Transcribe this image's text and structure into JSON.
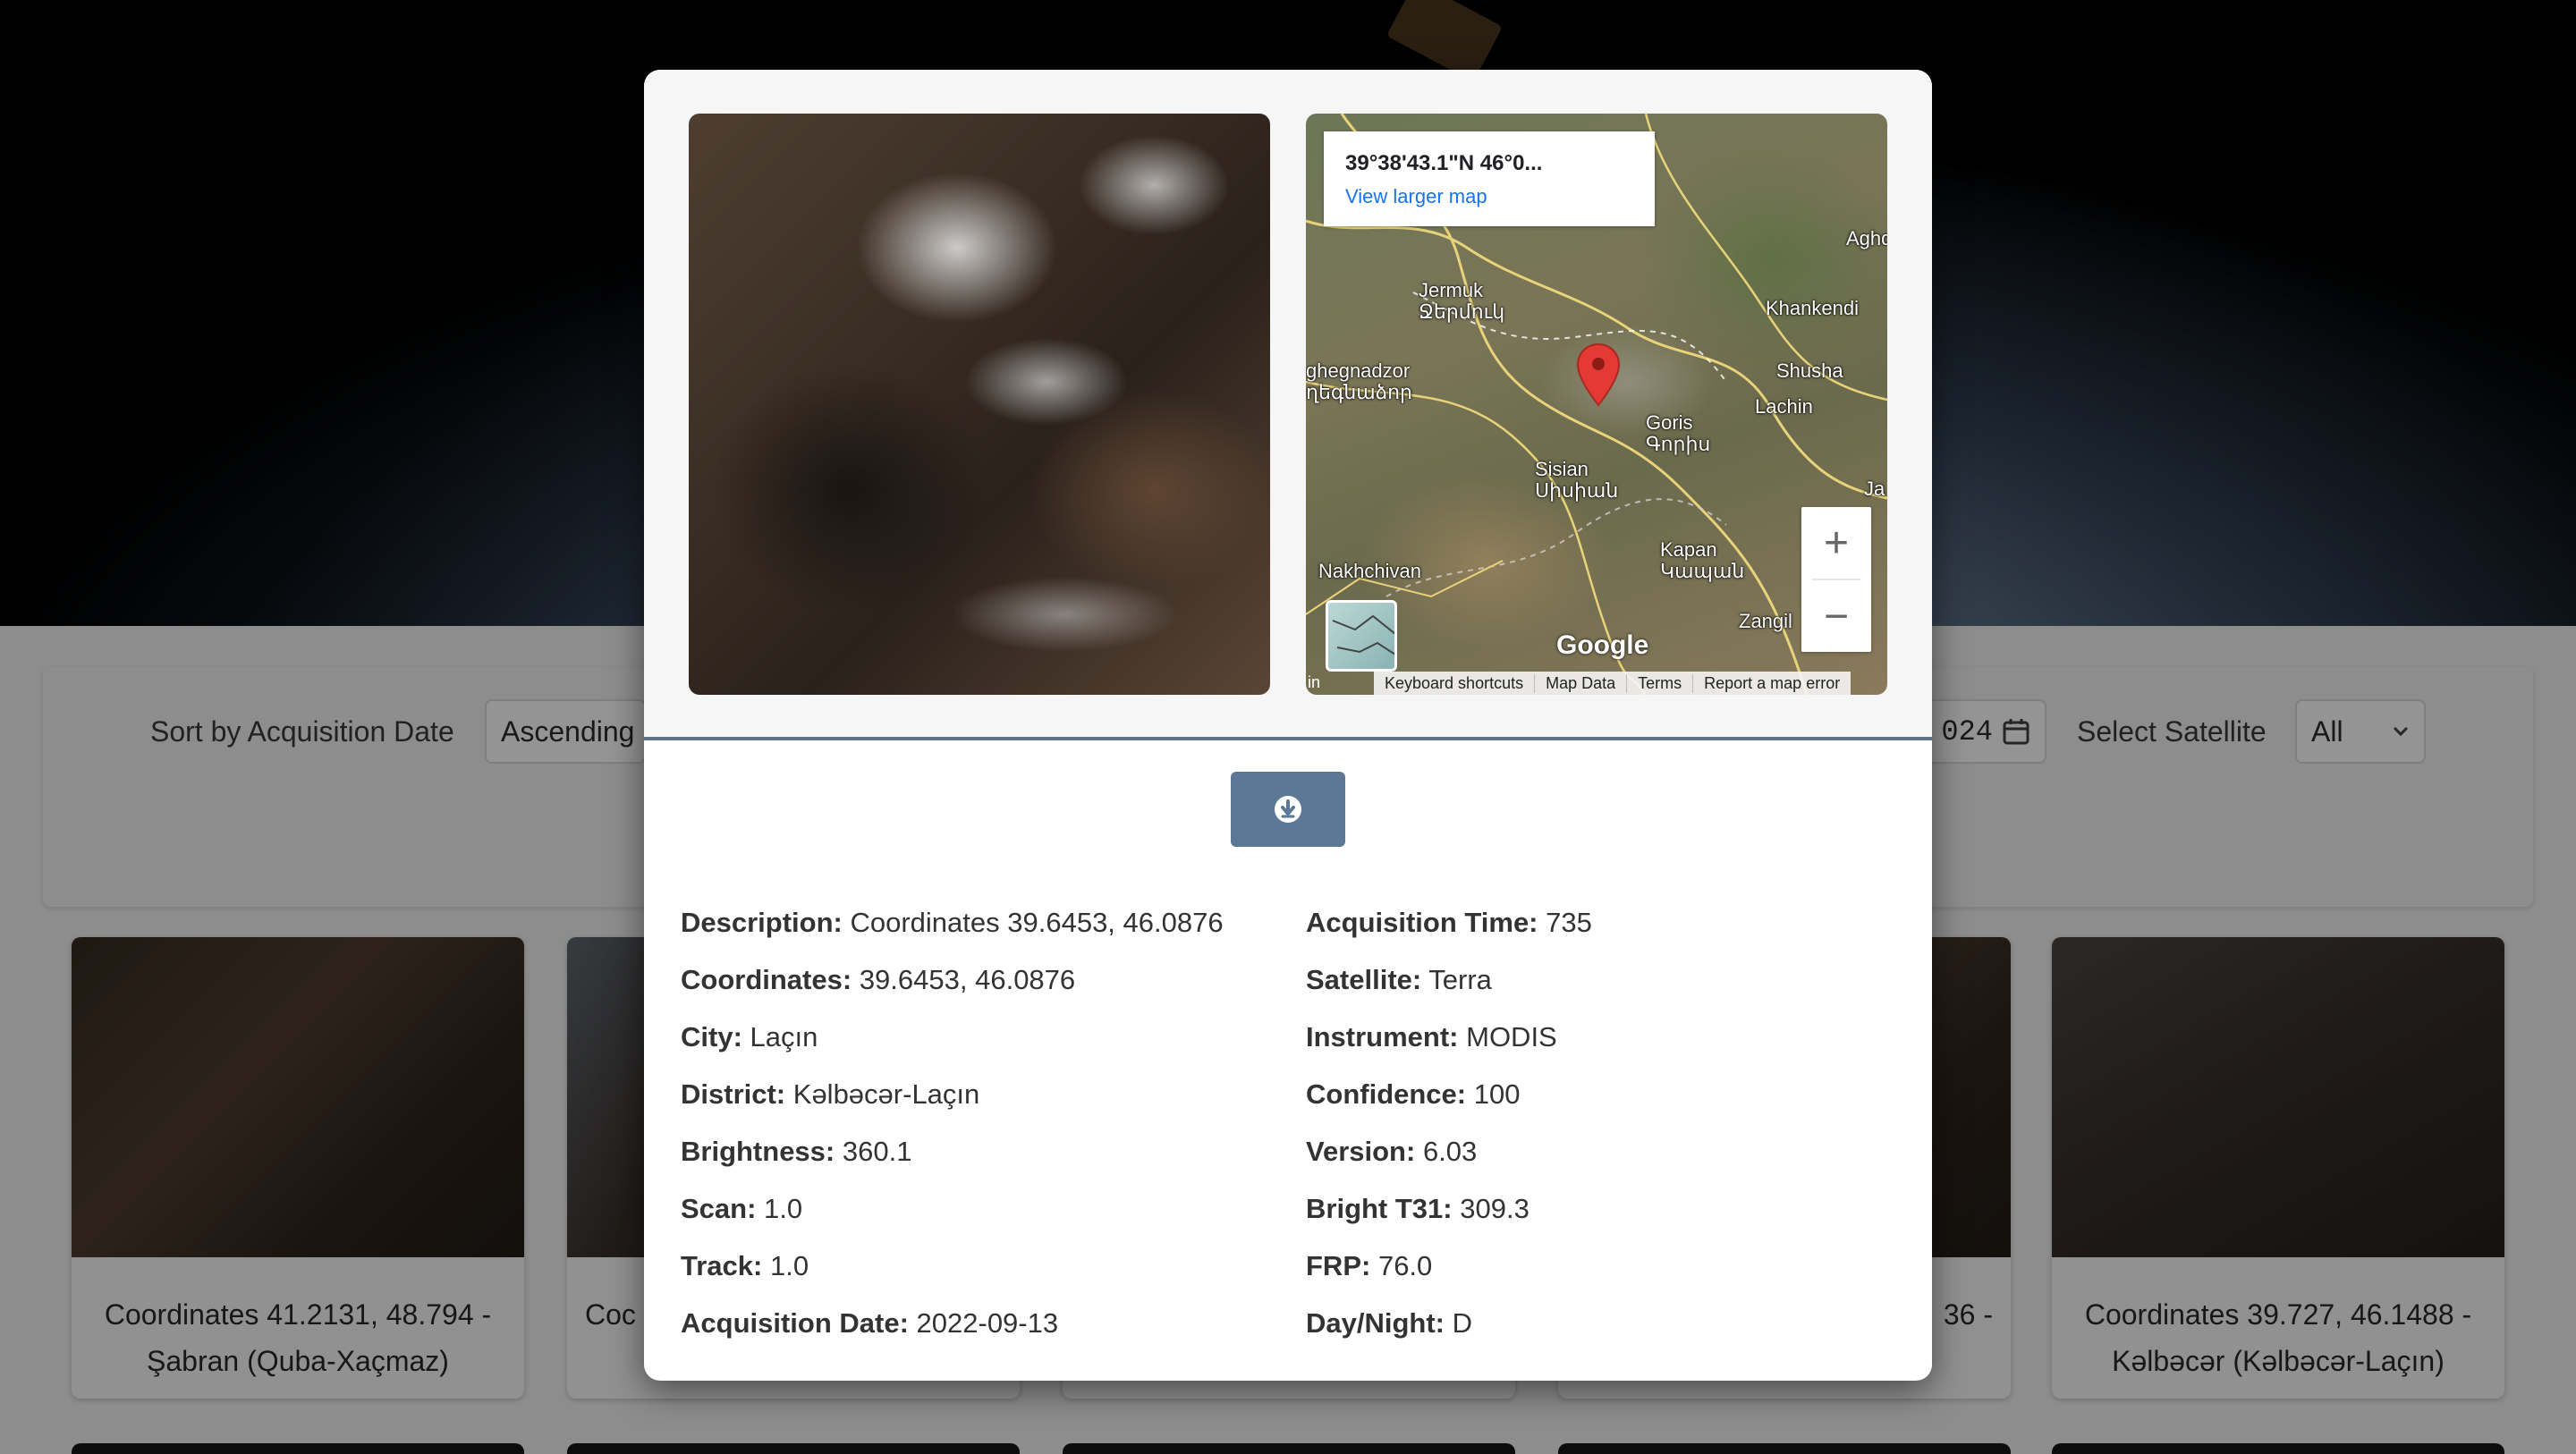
{
  "filters": {
    "sort_label": "Sort by Acquisition Date",
    "sort_value": "Ascending",
    "date_value_fragment": "024",
    "satellite_label": "Select Satellite",
    "satellite_value": "All"
  },
  "cards": [
    {
      "line1": "Coordinates 41.2131, 48.794 -",
      "line2": "Şabran (Quba-Xaçmaz)"
    },
    {
      "line1": "Coc",
      "line2": ""
    },
    {
      "line1": "36 -",
      "line2": ""
    },
    {
      "line1": "Coordinates 39.727, 46.1488 -",
      "line2": "Kəlbəcər (Kəlbəcər-Laçın)"
    }
  ],
  "map": {
    "infobox_coord": "39°38'43.1\"N 46°0...",
    "infobox_link": "View larger map",
    "places": [
      {
        "name": "Jermuk",
        "sub": "Ջերմուկ"
      },
      {
        "name": "ghegnadzor",
        "sub": "ղեգնաձոր"
      },
      {
        "name": "Khankendi",
        "sub": ""
      },
      {
        "name": "Aghda",
        "sub": ""
      },
      {
        "name": "Shusha",
        "sub": ""
      },
      {
        "name": "Lachin",
        "sub": ""
      },
      {
        "name": "Goris",
        "sub": "Գորիս"
      },
      {
        "name": "Sisian",
        "sub": "Սիսիան"
      },
      {
        "name": "Kapan",
        "sub": "Կապան"
      },
      {
        "name": "Nakhchivan",
        "sub": ""
      },
      {
        "name": "Zangil",
        "sub": ""
      },
      {
        "name": "Ja",
        "sub": ""
      }
    ],
    "zoom_in": "+",
    "zoom_out": "−",
    "google": "Google",
    "footer": [
      "Keyboard shortcuts",
      "Map Data",
      "Terms",
      "Report a map error"
    ]
  },
  "details_left": [
    {
      "label": "Description:",
      "value": "Coordinates 39.6453, 46.0876"
    },
    {
      "label": "Coordinates:",
      "value": "39.6453, 46.0876"
    },
    {
      "label": "City:",
      "value": "Laçın"
    },
    {
      "label": "District:",
      "value": "Kəlbəcər-Laçın"
    },
    {
      "label": "Brightness:",
      "value": "360.1"
    },
    {
      "label": "Scan:",
      "value": "1.0"
    },
    {
      "label": "Track:",
      "value": "1.0"
    },
    {
      "label": "Acquisition Date:",
      "value": "2022-09-13"
    }
  ],
  "details_right": [
    {
      "label": "Acquisition Time:",
      "value": "735"
    },
    {
      "label": "Satellite:",
      "value": "Terra"
    },
    {
      "label": "Instrument:",
      "value": "MODIS"
    },
    {
      "label": "Confidence:",
      "value": "100"
    },
    {
      "label": "Version:",
      "value": "6.03"
    },
    {
      "label": "Bright T31:",
      "value": "309.3"
    },
    {
      "label": "FRP:",
      "value": "76.0"
    },
    {
      "label": "Day/Night:",
      "value": "D"
    }
  ],
  "colors": {
    "modal_divider": "#5e7389",
    "download_button": "#5c7895",
    "map_pin": "#e53935",
    "map_link": "#1a73e8"
  },
  "icons": {
    "download": "download-circle-icon",
    "pin": "map-pin-icon",
    "calendar": "calendar-icon",
    "select": "chevron-down-icon"
  }
}
